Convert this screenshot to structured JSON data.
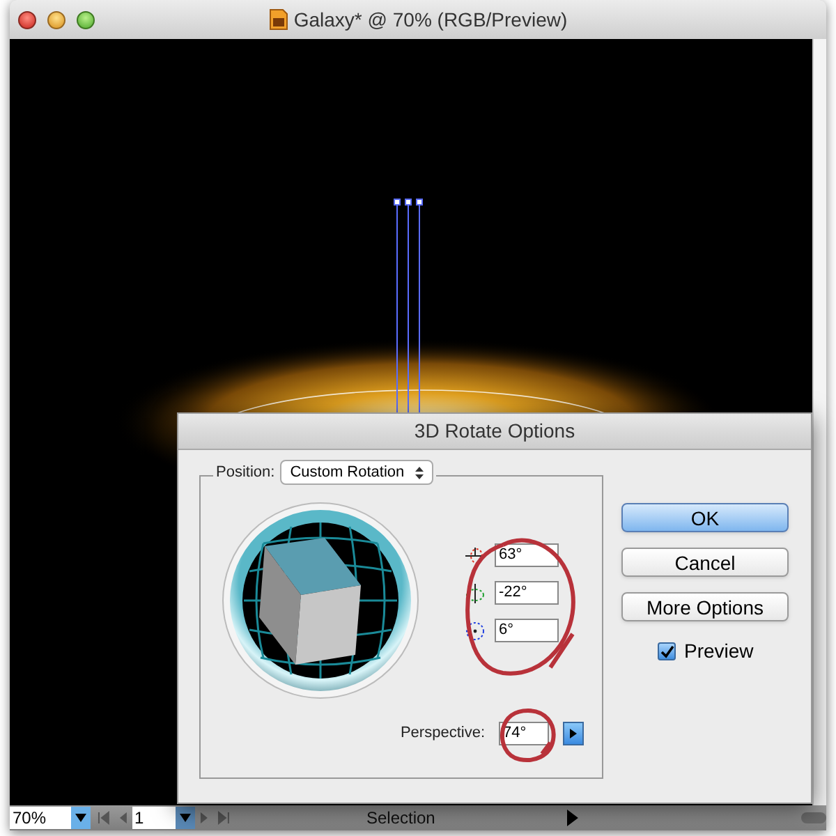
{
  "window": {
    "title": "Galaxy* @ 70% (RGB/Preview)"
  },
  "dialog": {
    "title": "3D Rotate Options",
    "position": {
      "label": "Position:",
      "value": "Custom Rotation"
    },
    "rotations": [
      {
        "kind": "x",
        "value": "63°"
      },
      {
        "kind": "y",
        "value": "-22°"
      },
      {
        "kind": "z",
        "value": "6°"
      }
    ],
    "perspective": {
      "label": "Perspective:",
      "value": "74°"
    },
    "buttons": [
      {
        "label": "OK",
        "kind": "default"
      },
      {
        "label": "Cancel",
        "kind": "normal"
      },
      {
        "label": "More Options",
        "kind": "normal"
      }
    ],
    "preview": {
      "label": "Preview",
      "checked": true
    }
  },
  "status_bar": {
    "zoom": "70%",
    "page": "1",
    "tool": "Selection"
  }
}
